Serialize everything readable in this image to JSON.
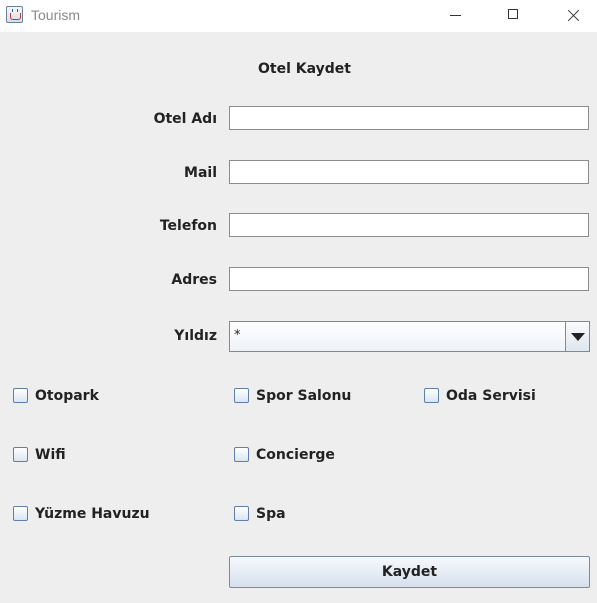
{
  "window": {
    "title": "Tourism",
    "icons": {
      "app": "java-cup-icon",
      "minimize": "minimize-icon",
      "maximize": "maximize-icon",
      "close": "close-icon"
    }
  },
  "form": {
    "title": "Otel Kaydet",
    "fields": {
      "name": {
        "label": "Otel Adı",
        "value": ""
      },
      "mail": {
        "label": "Mail",
        "value": ""
      },
      "phone": {
        "label": "Telefon",
        "value": ""
      },
      "address": {
        "label": "Adres",
        "value": ""
      }
    },
    "stars": {
      "label": "Yıldız",
      "selected": "*"
    },
    "features": {
      "parking": {
        "label": "Otopark",
        "checked": false
      },
      "gym": {
        "label": "Spor Salonu",
        "checked": false
      },
      "room_service": {
        "label": "Oda Servisi",
        "checked": false
      },
      "wifi": {
        "label": "Wifi",
        "checked": false
      },
      "concierge": {
        "label": "Concierge",
        "checked": false
      },
      "pool": {
        "label": "Yüzme Havuzu",
        "checked": false
      },
      "spa": {
        "label": "Spa",
        "checked": false
      }
    },
    "submit_label": "Kaydet"
  }
}
